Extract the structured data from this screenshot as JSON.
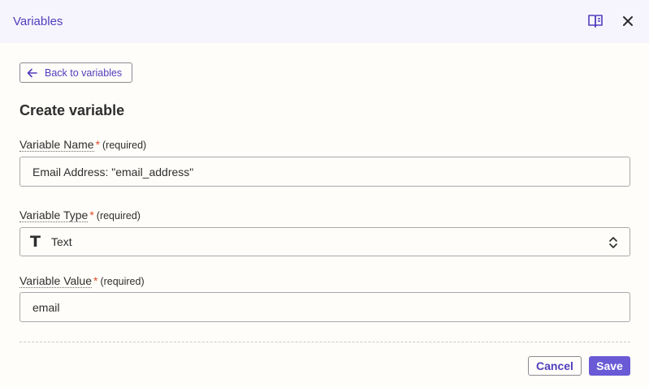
{
  "header": {
    "title": "Variables",
    "icons": [
      "book-open-icon",
      "close-icon"
    ]
  },
  "back_button": {
    "label": "Back to variables",
    "icon": "arrow-left-icon"
  },
  "form": {
    "title": "Create variable",
    "fields": [
      {
        "label": "Variable Name",
        "required_mark": "*",
        "required_text": "(required)",
        "value": "Email Address: \"email_address\""
      },
      {
        "label": "Variable Type",
        "required_mark": "*",
        "required_text": "(required)",
        "value": "Text",
        "icon": "T"
      },
      {
        "label": "Variable Value",
        "required_mark": "*",
        "required_text": "(required)",
        "value": "email"
      }
    ]
  },
  "footer": {
    "cancel_label": "Cancel",
    "save_label": "Save"
  },
  "colors": {
    "accent": "#503ebd",
    "primary_button": "#6a5ad6",
    "required": "#e04b2a",
    "header_bg": "#f6f5fd",
    "page_bg": "#fffdf9"
  }
}
